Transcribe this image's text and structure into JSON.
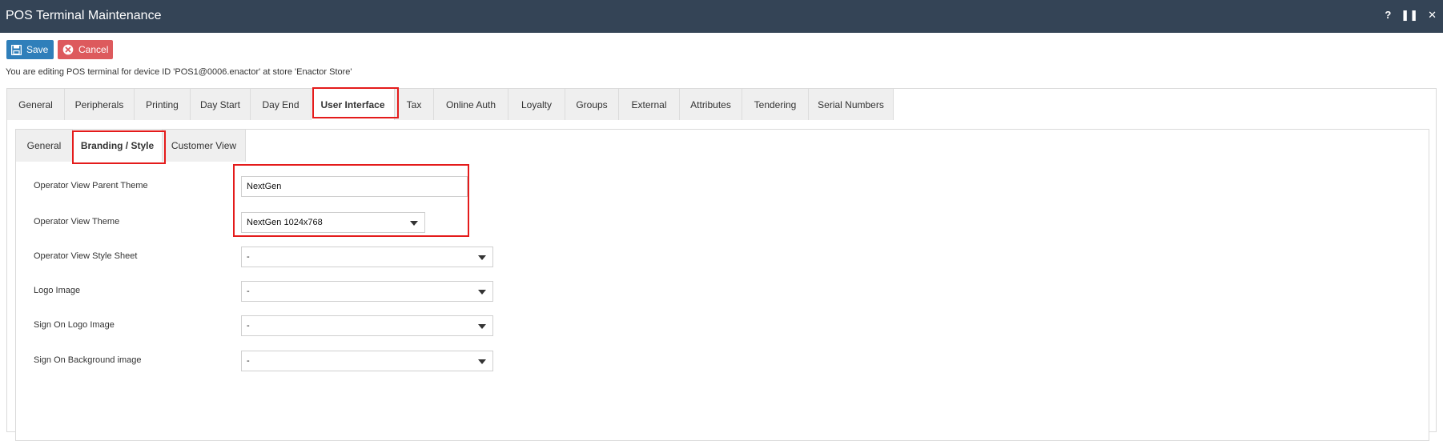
{
  "window": {
    "title": "POS Terminal Maintenance",
    "controls": [
      "?",
      "❚❚",
      "✕"
    ]
  },
  "toolbar": {
    "save_label": "Save",
    "cancel_label": "Cancel"
  },
  "editing_message": "You are editing POS terminal for device ID 'POS1@0006.enactor' at store 'Enactor Store'",
  "main_tabs": [
    "General",
    "Peripherals",
    "Printing",
    "Day Start",
    "Day End",
    "User Interface",
    "Tax",
    "Online Auth",
    "Loyalty",
    "Groups",
    "External",
    "Attributes",
    "Tendering",
    "Serial Numbers"
  ],
  "main_tab_active": "User Interface",
  "sub_tabs": [
    "General",
    "Branding / Style",
    "Customer View"
  ],
  "sub_tab_active": "Branding / Style",
  "form": {
    "parent_theme": {
      "label": "Operator View Parent Theme",
      "value": "NextGen"
    },
    "theme": {
      "label": "Operator View Theme",
      "value": "NextGen 1024x768"
    },
    "style_sheet": {
      "label": "Operator View Style Sheet",
      "value": "-"
    },
    "logo_image": {
      "label": "Logo Image",
      "value": "-"
    },
    "sign_on_logo": {
      "label": "Sign On Logo Image",
      "value": "-"
    },
    "sign_on_bg": {
      "label": "Sign On Background image",
      "value": "-"
    }
  },
  "colors": {
    "titlebar": "#344456",
    "save": "#2f7fba",
    "cancel": "#dd5a5d",
    "highlight": "#e41b1b"
  }
}
